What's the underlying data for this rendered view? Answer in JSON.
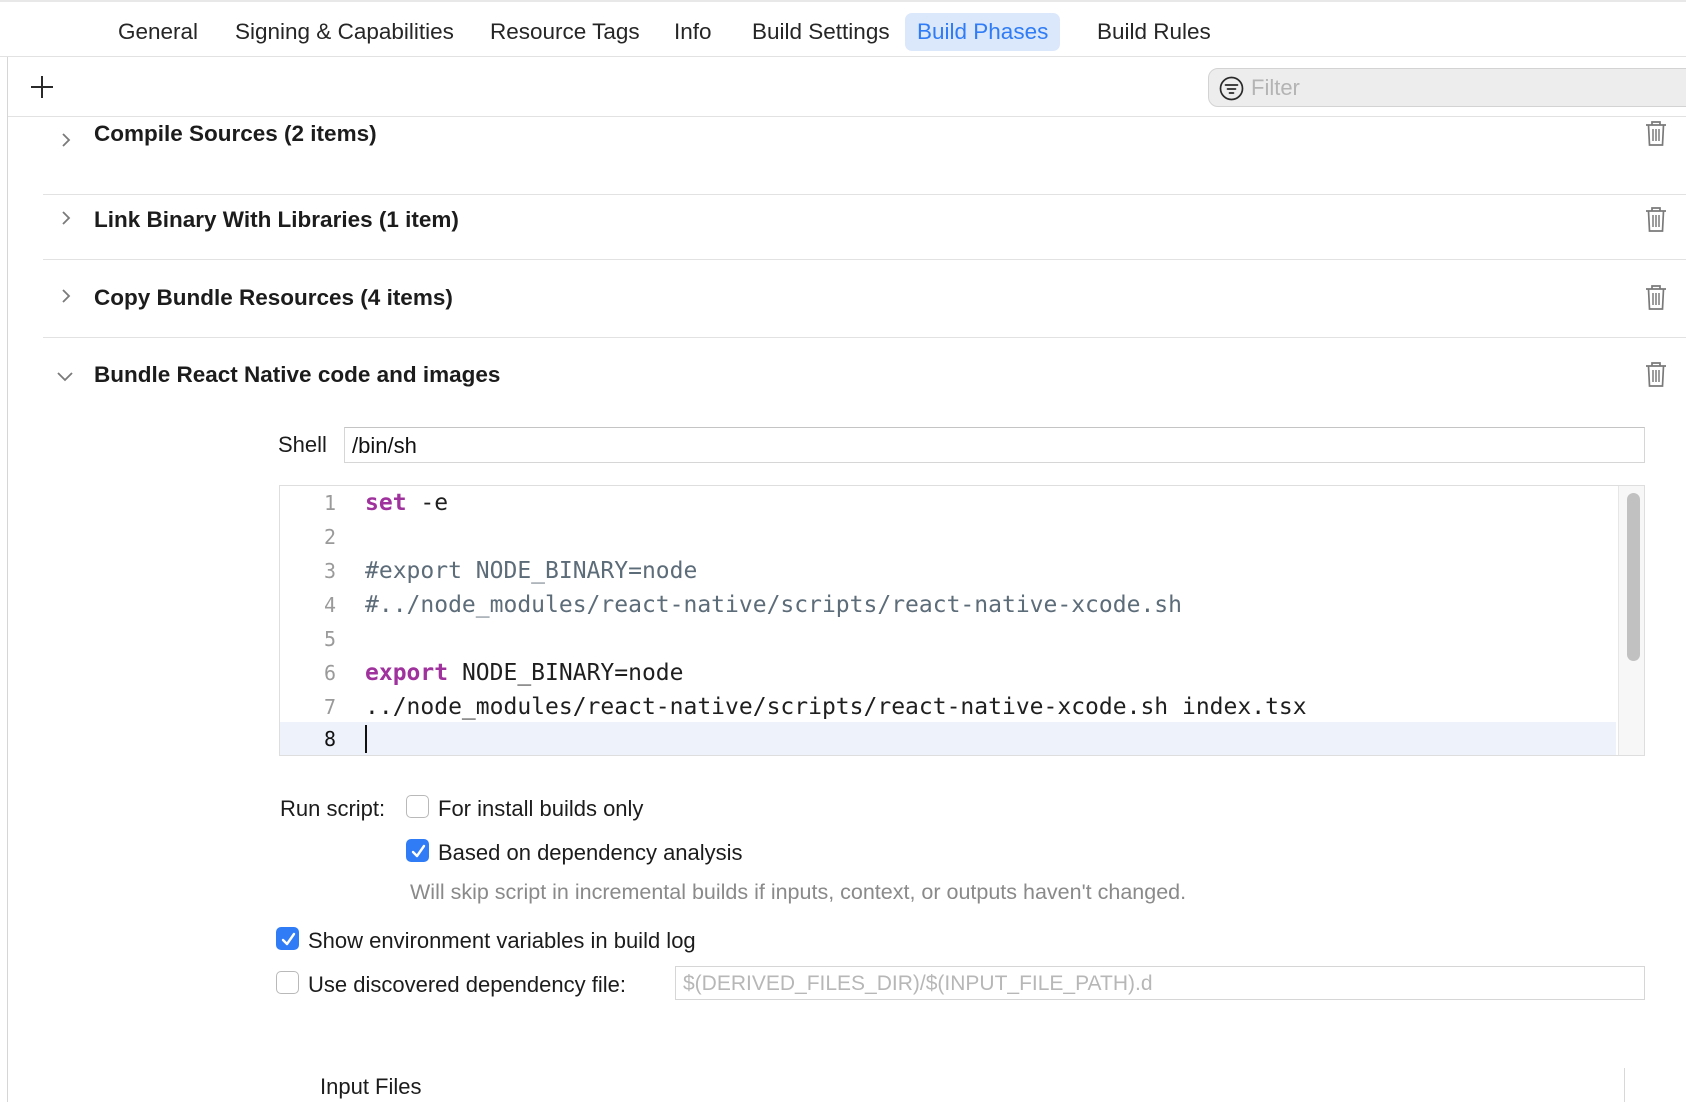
{
  "tabs": [
    {
      "label": "General",
      "active": false
    },
    {
      "label": "Signing & Capabilities",
      "active": false
    },
    {
      "label": "Resource Tags",
      "active": false
    },
    {
      "label": "Info",
      "active": false
    },
    {
      "label": "Build Settings",
      "active": false
    },
    {
      "label": "Build Phases",
      "active": true
    },
    {
      "label": "Build Rules",
      "active": false
    }
  ],
  "toolbar": {
    "add_icon": "plus-icon",
    "filter_placeholder": "Filter",
    "filter_icon": "filter-icon"
  },
  "phases": [
    {
      "title": "Compile Sources (2 items)",
      "expanded": false
    },
    {
      "title": "Link Binary With Libraries (1 item)",
      "expanded": false
    },
    {
      "title": "Copy Bundle Resources (4 items)",
      "expanded": false
    },
    {
      "title": "Bundle React Native code and images",
      "expanded": true
    }
  ],
  "script_phase": {
    "shell_label": "Shell",
    "shell_value": "/bin/sh",
    "lines": [
      {
        "num": "1",
        "kw": "set",
        "rest": " -e",
        "comment": ""
      },
      {
        "num": "2",
        "kw": "",
        "rest": "",
        "comment": ""
      },
      {
        "num": "3",
        "kw": "",
        "rest": "",
        "comment": "#export NODE_BINARY=node"
      },
      {
        "num": "4",
        "kw": "",
        "rest": "",
        "comment": "#../node_modules/react-native/scripts/react-native-xcode.sh"
      },
      {
        "num": "5",
        "kw": "",
        "rest": "",
        "comment": ""
      },
      {
        "num": "6",
        "kw": "export",
        "rest": " NODE_BINARY=node",
        "comment": ""
      },
      {
        "num": "7",
        "kw": "",
        "rest": "../node_modules/react-native/scripts/react-native-xcode.sh index.tsx",
        "comment": ""
      },
      {
        "num": "8",
        "kw": "",
        "rest": "",
        "comment": ""
      }
    ],
    "current_line": "8",
    "run_script_label": "Run script:",
    "install_builds_label": "For install builds only",
    "install_builds_checked": false,
    "dependency_analysis_label": "Based on dependency analysis",
    "dependency_analysis_checked": true,
    "dependency_hint": "Will skip script in incremental builds if inputs, context, or outputs haven't changed.",
    "show_env_label": "Show environment variables in build log",
    "show_env_checked": true,
    "dep_file_label": "Use discovered dependency file:",
    "dep_file_checked": false,
    "dep_file_placeholder": "$(DERIVED_FILES_DIR)/$(INPUT_FILE_PATH).d",
    "input_files_label": "Input Files"
  },
  "colors": {
    "accent": "#2f7cf6",
    "tab_active_bg": "#dbe8fb",
    "keyword": "#a0329e",
    "comment": "#5d6c79"
  }
}
